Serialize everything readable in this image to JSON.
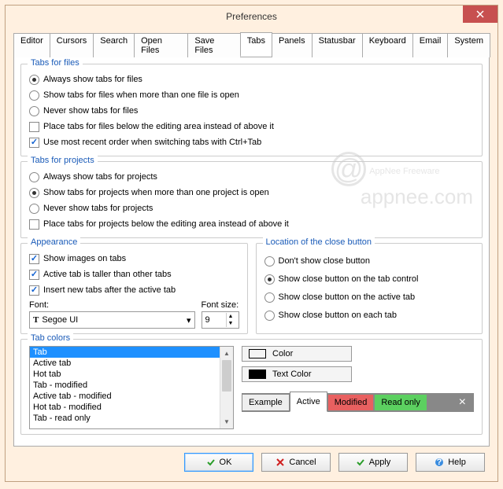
{
  "window": {
    "title": "Preferences"
  },
  "tabs": [
    "Editor",
    "Cursors",
    "Search",
    "Open Files",
    "Save Files",
    "Tabs",
    "Panels",
    "Statusbar",
    "Keyboard",
    "Email",
    "System"
  ],
  "active_tab": "Tabs",
  "group_files": {
    "legend": "Tabs for files",
    "r1": "Always show tabs for files",
    "r2": "Show tabs for files when more than one file is open",
    "r3": "Never show tabs for files",
    "c1": "Place tabs for files below the editing area instead of above it",
    "c2": "Use most recent order when switching tabs with Ctrl+Tab"
  },
  "group_projects": {
    "legend": "Tabs for projects",
    "r1": "Always show tabs for projects",
    "r2": "Show tabs for projects when more than one project is open",
    "r3": "Never show tabs for projects",
    "c1": "Place tabs for projects below the editing area instead of above it"
  },
  "appearance": {
    "legend": "Appearance",
    "c1": "Show images on tabs",
    "c2": "Active tab is taller than other tabs",
    "c3": "Insert new tabs after the active tab",
    "font_label": "Font:",
    "font_value": "Segoe UI",
    "fontsize_label": "Font size:",
    "fontsize_value": "9"
  },
  "closeloc": {
    "legend": "Location of the close button",
    "r1": "Don't show close button",
    "r2": "Show close button on the tab control",
    "r3": "Show close button on the active tab",
    "r4": "Show close button on each tab"
  },
  "tabcolors": {
    "legend": "Tab colors",
    "items": [
      "Tab",
      "Active tab",
      "Hot tab",
      "Tab - modified",
      "Active tab - modified",
      "Hot tab - modified",
      "Tab - read only"
    ],
    "selected": "Tab",
    "btn_color": "Color",
    "btn_text": "Text Color",
    "color_swatch": "#ffffff",
    "text_swatch": "#000000",
    "ex_example": "Example",
    "ex_active": "Active",
    "ex_modified": "Modified",
    "ex_readonly": "Read only"
  },
  "buttons": {
    "ok": "OK",
    "cancel": "Cancel",
    "apply": "Apply",
    "help": "Help"
  },
  "watermark": {
    "line1": "AppNee Freeware",
    "line2": "appnee.com",
    "at": "@"
  }
}
